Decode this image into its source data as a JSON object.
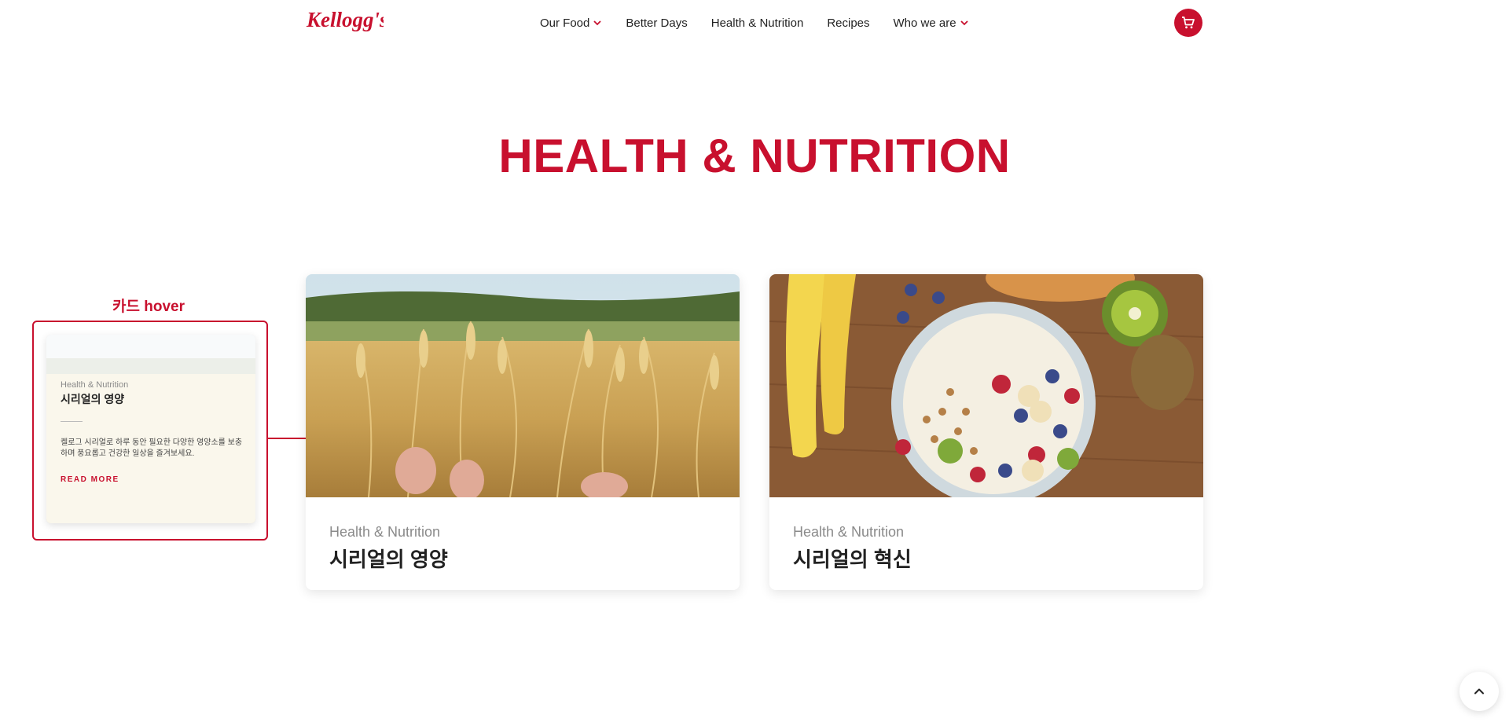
{
  "header": {
    "brand": "Kellogg's",
    "nav": [
      {
        "label": "Our Food",
        "has_dropdown": true
      },
      {
        "label": "Better Days",
        "has_dropdown": false
      },
      {
        "label": "Health & Nutrition",
        "has_dropdown": false
      },
      {
        "label": "Recipes",
        "has_dropdown": false
      },
      {
        "label": "Who we are",
        "has_dropdown": true
      }
    ],
    "cart_icon": "cart-icon"
  },
  "page": {
    "title": "HEALTH & NUTRITION"
  },
  "cards": [
    {
      "category": "Health & Nutrition",
      "title": "시리얼의 영양",
      "image": "wheat-field-photo"
    },
    {
      "category": "Health & Nutrition",
      "title": "시리얼의 혁신",
      "image": "cereal-bowl-fruit-photo"
    }
  ],
  "hover_demo": {
    "label": "카드 hover",
    "category": "Health & Nutrition",
    "title": "시리얼의 영양",
    "description": "켈로그 시리얼로 하루 동안 필요한 다양한 영양소를 보충하며 풍요롭고 건강한 일상을 즐겨보세요.",
    "cta": "READ MORE"
  },
  "colors": {
    "brand_red": "#c8102e",
    "text_dark": "#222222",
    "text_muted": "#8a8a8a"
  },
  "scroll_top_icon": "chevron-up-icon"
}
